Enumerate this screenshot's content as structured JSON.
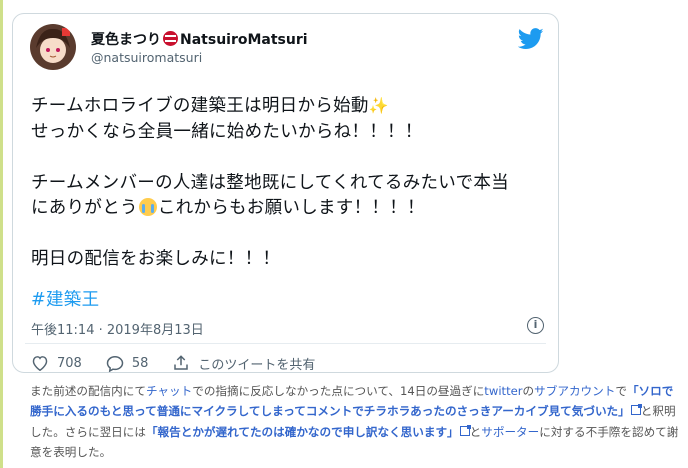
{
  "tweet": {
    "author": {
      "name_prefix": "夏色まつり",
      "name_suffix": "NatsuiroMatsuri",
      "handle": "@natsuiromatsuri"
    },
    "body": {
      "line1": "チームホロライブの建築王は明日から始動",
      "line2": "せっかくなら全員一緒に始めたいからね！！！！",
      "line3": "チームメンバーの人達は整地既にしてくれてるみたいで本当",
      "line4a": "にありがとう",
      "line4b": "これからもお願いします！！！！",
      "line5": "明日の配信をお楽しみに！！！"
    },
    "hashtag": "#建築王",
    "timestamp": "午後11:14 · 2019年8月13日",
    "actions": {
      "like_count": "708",
      "reply_count": "58",
      "share_label": "このツイートを共有"
    },
    "colors": {
      "accent": "#1d9bf0",
      "muted": "#536471",
      "border": "#cfd9de"
    }
  },
  "note": {
    "s1": "また前述の配信内にて",
    "link_chat": "チャット",
    "s2": "での指摘に反応しなかった点について、14日の昼過ぎに",
    "link_twitter": "twitter",
    "s3": "の",
    "link_sub": "サブアカウント",
    "s4": "で",
    "quote1": "「ソロで勝手に入るのもと思って普通にマイクラしてしまってコメントでチラホラあったのさっきアーカイブ見て気づいた」",
    "s5": "と釈明した。さらに翌日には",
    "quote2": "「報告とかが遅れてたのは確かなので申し訳なく思います」",
    "s6": "と",
    "link_supporter": "サポーター",
    "s7": "に対する不手際を認めて謝意を表明した。"
  }
}
